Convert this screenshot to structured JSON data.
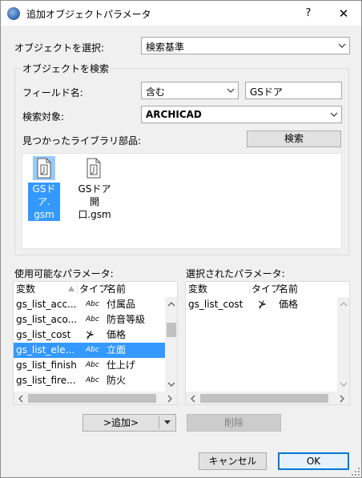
{
  "window": {
    "title": "追加オブジェクトパラメータ",
    "help": "?",
    "close": "✕"
  },
  "select_object": {
    "label": "オブジェクトを選択:",
    "value": "検索基準"
  },
  "search_group": {
    "title": "オブジェクトを検索",
    "field_label": "フィールド名:",
    "operator_value": "含む",
    "field_value": "GSドア",
    "target_label": "検索対象:",
    "target_value": "ARCHICAD",
    "found_label": "見つかったライブラリ部品:",
    "search_button": "検索",
    "items": [
      {
        "name": "GSドア.gsm",
        "line1": "GSドア.",
        "line2": "gsm",
        "selected": true
      },
      {
        "name": "GSドア開口.gsm",
        "line1": "GSドア開",
        "line2": "口.gsm",
        "selected": false
      }
    ]
  },
  "available": {
    "label": "使用可能なパラメータ:",
    "columns": {
      "var": "変数",
      "type": "タイプ",
      "name": "名前"
    },
    "rows": [
      {
        "var": "gs_list_acc...",
        "type": "Abc",
        "name": "付属品",
        "selected": false
      },
      {
        "var": "gs_list_aco...",
        "type": "Abc",
        "name": "防音等級",
        "selected": false
      },
      {
        "var": "gs_list_cost",
        "type": "⊁",
        "name": "価格",
        "selected": false
      },
      {
        "var": "gs_list_ele...",
        "type": "Abc",
        "name": "立面",
        "selected": true
      },
      {
        "var": "gs_list_finish",
        "type": "Abc",
        "name": "仕上げ",
        "selected": false
      },
      {
        "var": "gs_list_fire...",
        "type": "Abc",
        "name": "防火",
        "selected": false
      }
    ]
  },
  "selected_params": {
    "label": "選択されたパラメータ:",
    "columns": {
      "var": "変数",
      "type": "タイプ",
      "name": "名前"
    },
    "rows": [
      {
        "var": "gs_list_cost",
        "type": "⊁",
        "name": "価格"
      }
    ]
  },
  "buttons": {
    "add": ">追加>",
    "remove": "削除",
    "cancel": "キャンセル",
    "ok": "OK"
  },
  "colors": {
    "selection": "#3399ff",
    "primary_border": "#0078d7",
    "dialog_bg": "#f0f0f0"
  }
}
